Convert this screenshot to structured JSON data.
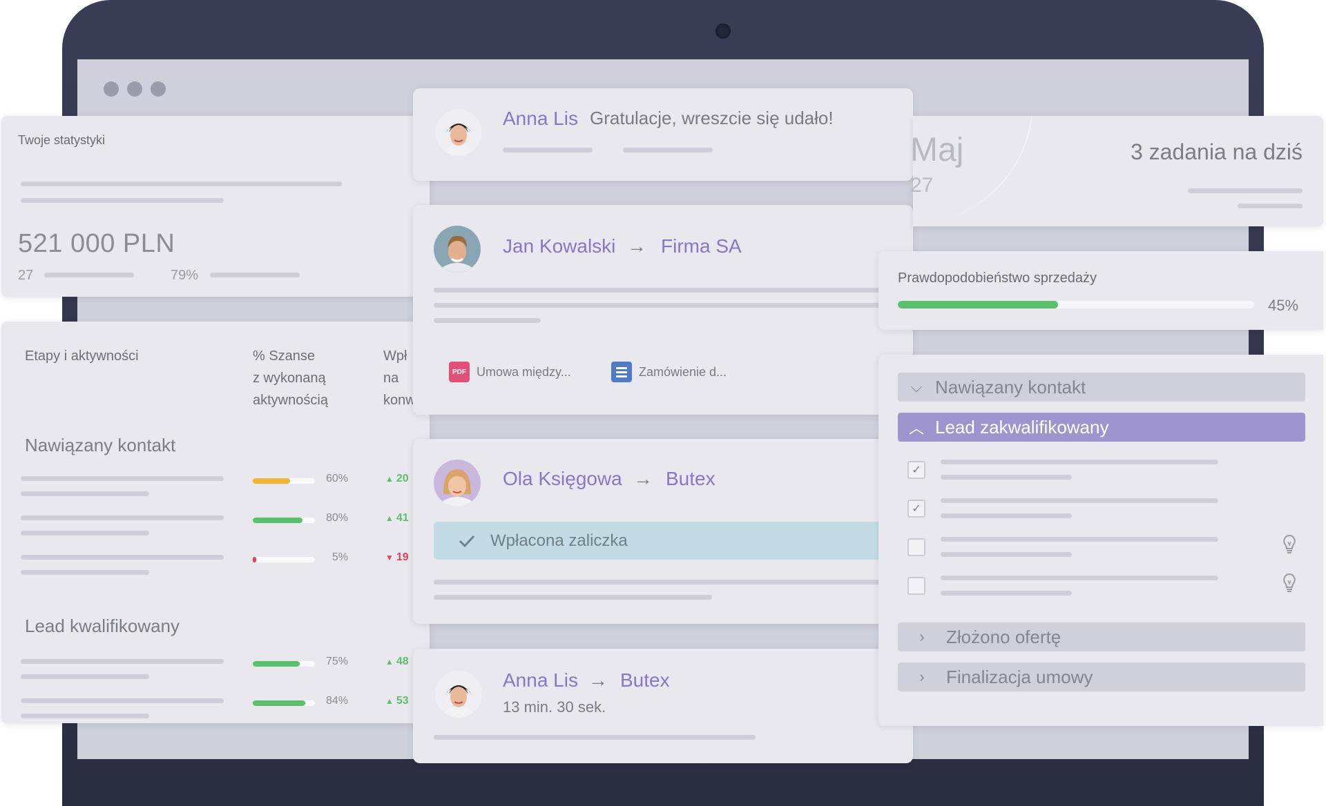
{
  "stats": {
    "title": "Twoje statystyki",
    "amount": "521 000 PLN",
    "count": "27",
    "percent": "79%"
  },
  "stages_table": {
    "headers": {
      "stage": "Etapy i aktywności",
      "chance_l1": "% Szanse",
      "chance_l2": "z wykonaną",
      "chance_l3": "aktywnością",
      "impact_l1": "Wpł",
      "impact_l2": "na",
      "impact_l3": "konw"
    },
    "groups": [
      {
        "title": "Nawiązany kontakt",
        "rows": [
          {
            "pct": 60,
            "pct_label": "60%",
            "color": "#f2b431",
            "delta": "20",
            "dir": "up"
          },
          {
            "pct": 80,
            "pct_label": "80%",
            "color": "#5cbf6c",
            "delta": "41",
            "dir": "up"
          },
          {
            "pct": 5,
            "pct_label": "5%",
            "color": "#e2435a",
            "delta": "19",
            "dir": "down"
          }
        ]
      },
      {
        "title": "Lead kwalifikowany",
        "rows": [
          {
            "pct": 75,
            "pct_label": "75%",
            "color": "#5cbf6c",
            "delta": "48",
            "dir": "up"
          },
          {
            "pct": 84,
            "pct_label": "84%",
            "color": "#5cbf6c",
            "delta": "53",
            "dir": "up"
          }
        ]
      }
    ]
  },
  "feed": {
    "message_card": {
      "name": "Anna Lis",
      "text": "Gratulacje, wreszcie się udało!"
    },
    "card_jan": {
      "name": "Jan Kowalski",
      "arrow": "→",
      "company": "Firma SA",
      "attachments": [
        "Umowa między...",
        "Zamówienie d..."
      ],
      "pdf_label": "PDF"
    },
    "card_ola": {
      "name": "Ola Księgowa",
      "arrow": "→",
      "company": "Butex",
      "paid_label": "Wpłacona zaliczka"
    },
    "card_anna2": {
      "name": "Anna Lis",
      "arrow": "→",
      "company": "Butex",
      "time": "13 min. 30 sek."
    }
  },
  "calendar": {
    "month": "Maj",
    "day": "27",
    "tasks": "3 zadania na dziś"
  },
  "probability": {
    "title": "Prawdopodobieństwo sprzedaży",
    "value": 45,
    "label": "45%"
  },
  "pipeline": {
    "stages": [
      {
        "label": "Nawiązany kontakt",
        "state": "collapsed-down"
      },
      {
        "label": "Lead zakwalifikowany",
        "state": "active"
      },
      {
        "label": "Złożono ofertę",
        "state": "collapsed"
      },
      {
        "label": "Finalizacja umowy",
        "state": "collapsed"
      }
    ],
    "tasks": [
      {
        "checked": true,
        "hint": false
      },
      {
        "checked": true,
        "hint": false
      },
      {
        "checked": false,
        "hint": true
      },
      {
        "checked": false,
        "hint": true
      }
    ]
  },
  "colors": {
    "accent": "#8877c4",
    "success": "#5cbf6c",
    "warning": "#f2b431",
    "danger": "#e2435a"
  }
}
